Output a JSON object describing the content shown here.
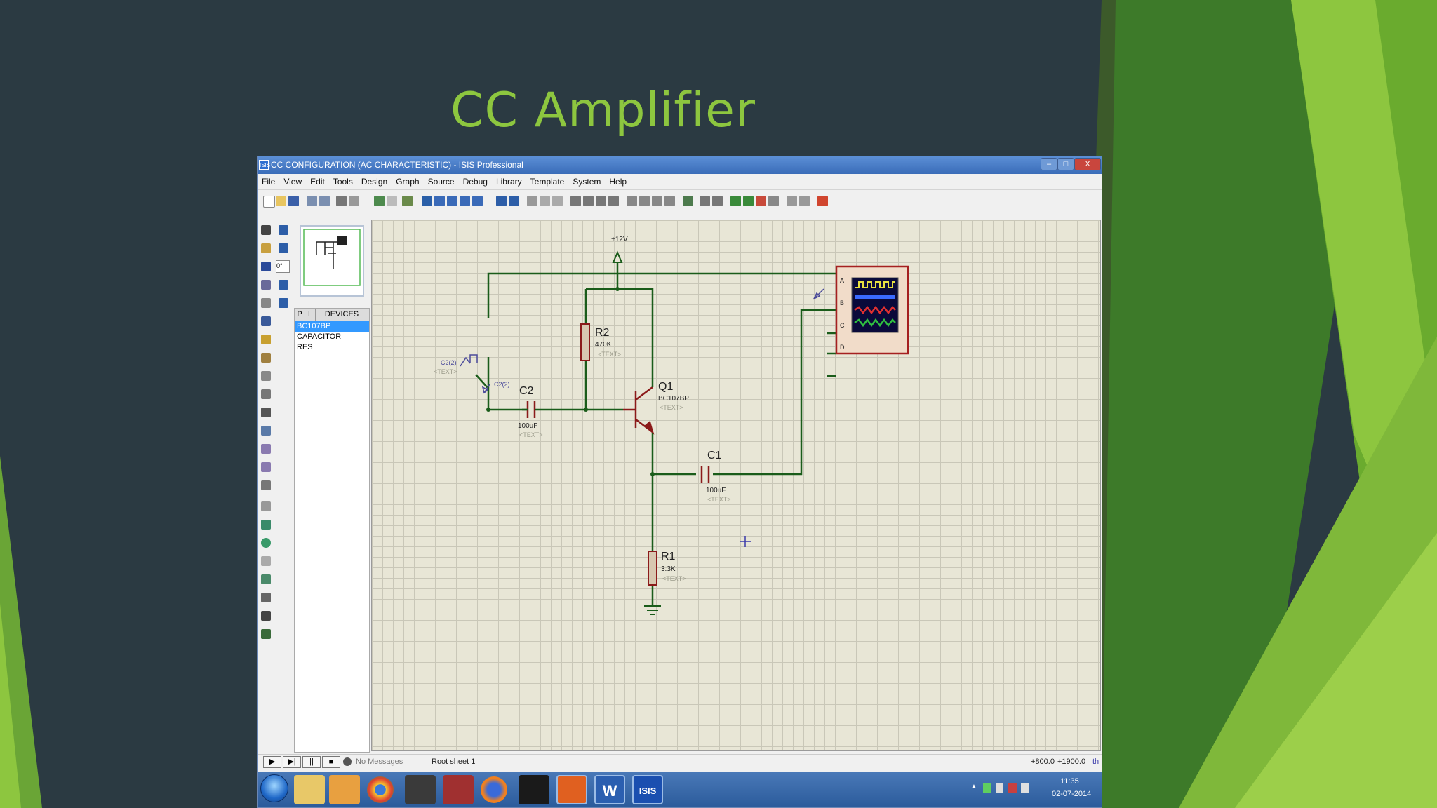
{
  "slide": {
    "title": "CC Amplifier"
  },
  "window": {
    "title": "CC CONFIGURATION (AC CHARACTERISTIC) - ISIS Professional",
    "app_icon": "ISIS",
    "buttons": {
      "minimize": "–",
      "maximize": "□",
      "close": "X"
    }
  },
  "menu": [
    "File",
    "View",
    "Edit",
    "Tools",
    "Design",
    "Graph",
    "Source",
    "Debug",
    "Library",
    "Template",
    "System",
    "Help"
  ],
  "rotation_field": "0°",
  "panel": {
    "tabs": [
      "P",
      "L",
      "DEVICES"
    ],
    "devices": [
      "BC107BP",
      "CAPACITOR",
      "RES"
    ]
  },
  "schematic": {
    "supply_label": "+12V",
    "r2_name": "R2",
    "r2_value": "470K",
    "r1_name": "R1",
    "r1_value": "3.3K",
    "c2_name": "C2",
    "c2_value": "100uF",
    "c1_name": "C1",
    "c1_value": "100uF",
    "q1_name": "Q1",
    "q1_part": "BC107BP",
    "gen_label": "C2(2)",
    "probe_label": "C2(2)",
    "text_placeholder": "<TEXT>",
    "scope_channels": [
      "A",
      "B",
      "C",
      "D"
    ]
  },
  "statusbar": {
    "messages": "No Messages",
    "sheet": "Root sheet 1",
    "coord_x": "+800.0",
    "coord_y": "+1900.0",
    "units": "th"
  },
  "taskbar": {
    "apps": [
      "windows-explorer",
      "media-player",
      "chrome",
      "matlab",
      "autocad",
      "firefox",
      "media-app",
      "office",
      "word",
      "isis"
    ],
    "word_label": "W",
    "isis_label": "ISIS",
    "time": "11:35",
    "date": "02-07-2014"
  },
  "colors": {
    "slide_background": "#2b3a42",
    "title_green": "#8dc63f",
    "wire": "#1a5c1a",
    "canvas": "#e8e6d6"
  }
}
